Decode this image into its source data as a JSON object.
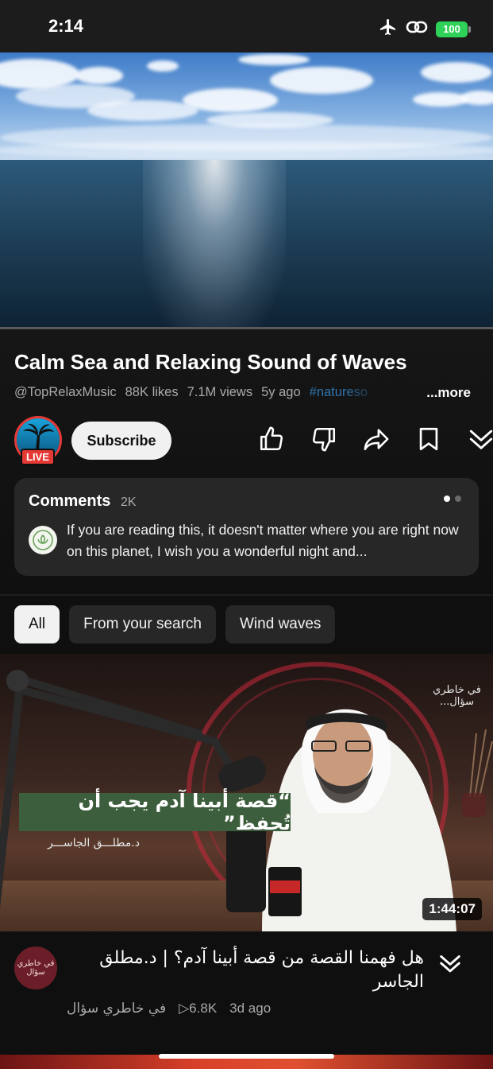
{
  "status_bar": {
    "time": "2:14",
    "battery": "100",
    "icons": [
      "airplane-icon",
      "link-icon",
      "battery-icon"
    ]
  },
  "player": {
    "progress": 0.0
  },
  "video": {
    "title": "Calm Sea and Relaxing Sound of Waves",
    "channel": "@TopRelaxMusic",
    "likes": "88K likes",
    "views": "7.1M views",
    "age": "5y ago",
    "hashtag": "#natureso",
    "more_label": "...more",
    "live_badge": "LIVE",
    "subscribe_label": "Subscribe",
    "actions": [
      "like-icon",
      "dislike-icon",
      "share-icon",
      "save-icon",
      "download-icon"
    ]
  },
  "comments": {
    "heading": "Comments",
    "count": "2K",
    "preview": "If you are reading this, it doesn't matter where you are right now on this planet, I wish you a wonderful night and..."
  },
  "chips": [
    {
      "label": "All",
      "active": true
    },
    {
      "label": "From your search",
      "active": false
    },
    {
      "label": "Wind waves",
      "active": false
    }
  ],
  "next_video": {
    "banner_text": "“قصة أبينا آدم يجب أن تُحفظ”",
    "speaker_text": "د.مطلـــق الجاســـر",
    "brand_text": "في خاطري سؤال...",
    "duration": "1:44:07",
    "avatar_text": "في خاطري سؤال",
    "title": "هل فهمنا القصة من قصة أبينا آدم؟ | د.مطلق الجاسر",
    "channel": "في خاطري سؤال",
    "views": "▷6.8K",
    "age": "3d ago"
  },
  "colors": {
    "background": "#0f0f0f",
    "card": "#272727",
    "live_red": "#e53935",
    "battery_green": "#30d158",
    "banner_green": "#3d5e3c"
  }
}
